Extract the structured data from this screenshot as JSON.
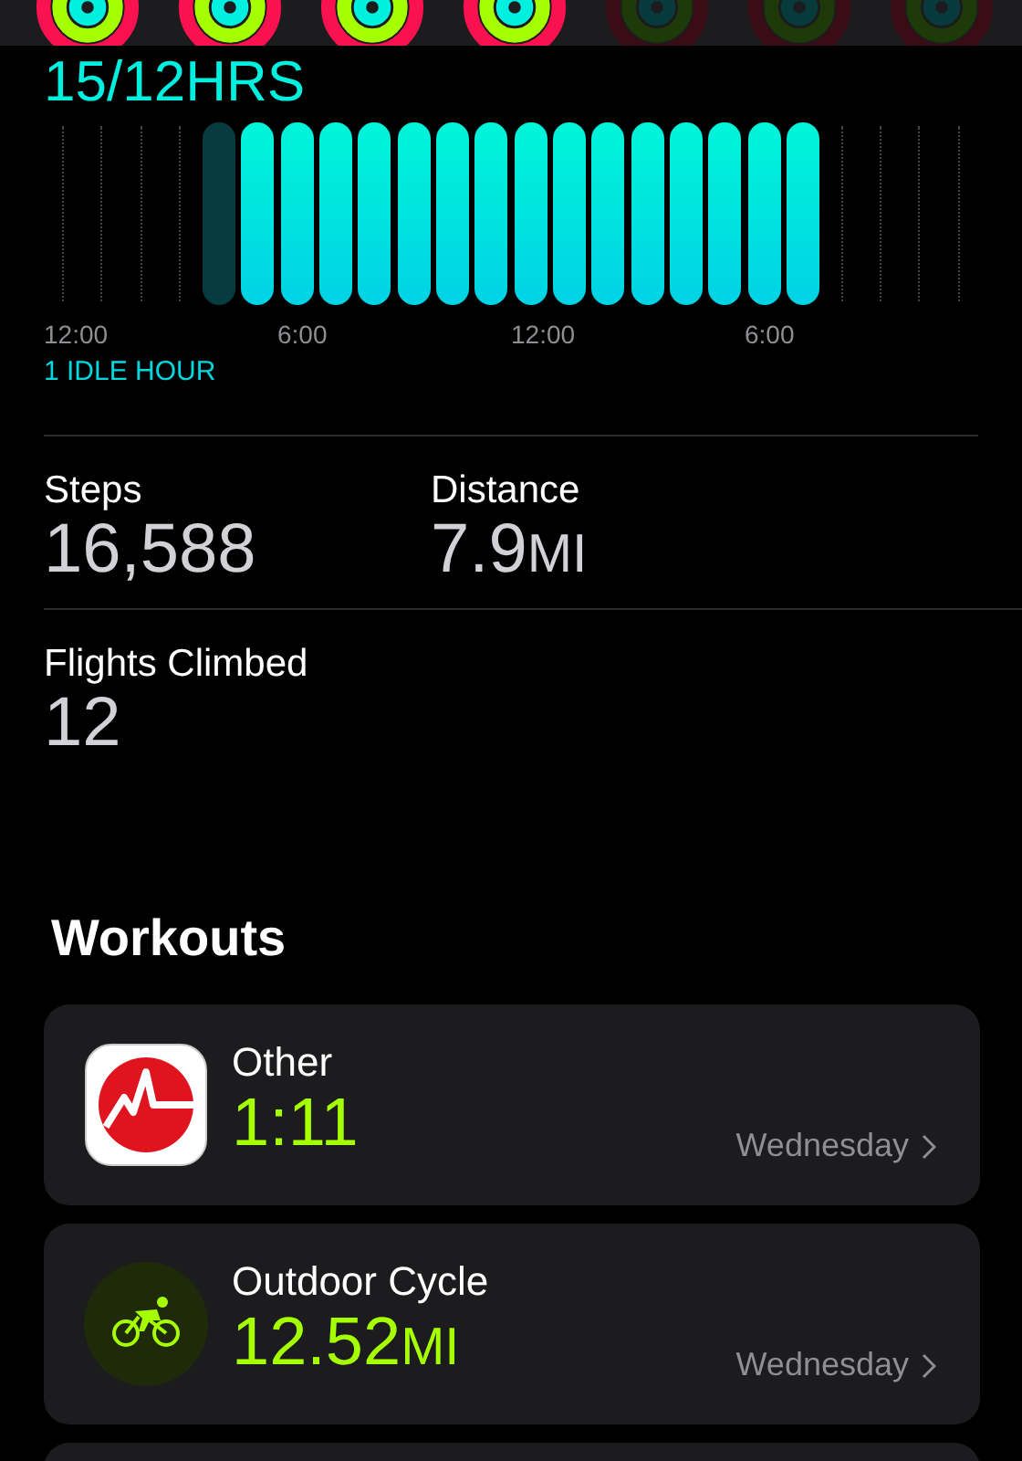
{
  "rings": [
    {
      "closed": true
    },
    {
      "closed": true
    },
    {
      "closed": true
    },
    {
      "closed": true
    },
    {
      "closed": false
    },
    {
      "closed": false
    },
    {
      "closed": false
    }
  ],
  "stand": {
    "value": "15/12",
    "unit": "HRS",
    "hours": [
      {
        "kind": "empty"
      },
      {
        "kind": "empty"
      },
      {
        "kind": "empty"
      },
      {
        "kind": "empty"
      },
      {
        "kind": "idle"
      },
      {
        "kind": "stood"
      },
      {
        "kind": "stood"
      },
      {
        "kind": "stood"
      },
      {
        "kind": "stood"
      },
      {
        "kind": "stood"
      },
      {
        "kind": "stood"
      },
      {
        "kind": "stood"
      },
      {
        "kind": "stood"
      },
      {
        "kind": "stood"
      },
      {
        "kind": "stood"
      },
      {
        "kind": "stood"
      },
      {
        "kind": "stood"
      },
      {
        "kind": "stood"
      },
      {
        "kind": "stood"
      },
      {
        "kind": "stood"
      },
      {
        "kind": "empty"
      },
      {
        "kind": "empty"
      },
      {
        "kind": "empty"
      },
      {
        "kind": "empty"
      }
    ],
    "axis_labels": [
      "12:00",
      "6:00",
      "12:00",
      "6:00"
    ],
    "idle": "1 IDLE HOUR"
  },
  "stats": [
    {
      "label": "Steps",
      "value": "16,588"
    },
    {
      "label": "Distance",
      "value": "7.9",
      "unit": "MI"
    },
    {
      "label": "Flights Climbed",
      "value": "12"
    }
  ],
  "workouts": {
    "title": "Workouts",
    "items": [
      {
        "kind": "other",
        "name": "Other",
        "value": "1:11",
        "day": "Wednesday"
      },
      {
        "kind": "cycle",
        "name": "Outdoor Cycle",
        "value": "12.52",
        "unit": "MI",
        "day": "Wednesday"
      }
    ]
  }
}
